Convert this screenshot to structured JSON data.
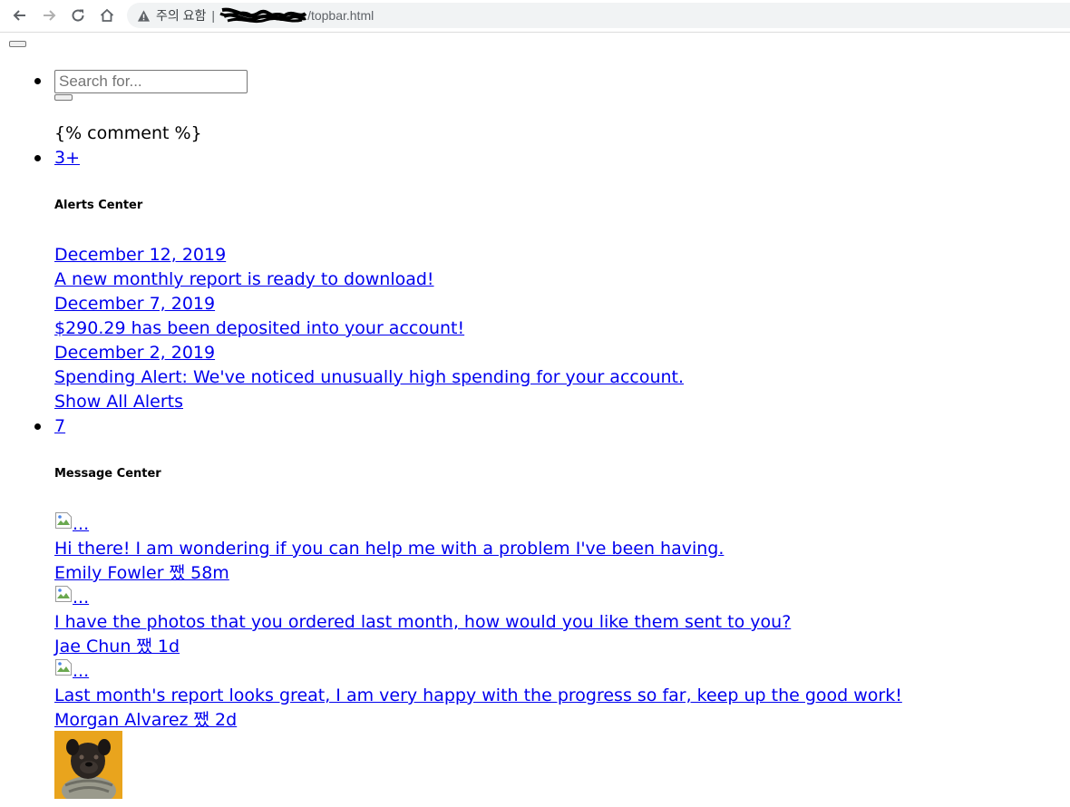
{
  "browser": {
    "warning_text": "주의 요함",
    "separator": "|",
    "url_path": "/topbar.html"
  },
  "search": {
    "placeholder": "Search for..."
  },
  "template_comment": "{% comment %}",
  "alerts": {
    "badge": "3+",
    "header": "Alerts Center",
    "items": [
      {
        "date": "December 12, 2019",
        "text": "A new monthly report is ready to download!"
      },
      {
        "date": "December 7, 2019",
        "text": "$290.29 has been deposited into your account!"
      },
      {
        "date": "December 2, 2019",
        "text": "Spending Alert: We've noticed unusually high spending for your account."
      }
    ],
    "show_all": "Show All Alerts"
  },
  "messages": {
    "badge": "7",
    "header": "Message Center",
    "img_alt": "...",
    "items": [
      {
        "text": "Hi there! I am wondering if you can help me with a problem I've been having.",
        "meta": "Emily Fowler 쨌 58m"
      },
      {
        "text": "I have the photos that you ordered last month, how would you like them sent to you?",
        "meta": "Jae Chun 쨌 1d"
      },
      {
        "text": "Last month's report looks great, I am very happy with the progress so far, keep up the good work!",
        "meta": "Morgan Alvarez 쨌 2d"
      }
    ]
  },
  "colors": {
    "link": "#0000ee",
    "avatar_bg": "#e9a41d"
  }
}
